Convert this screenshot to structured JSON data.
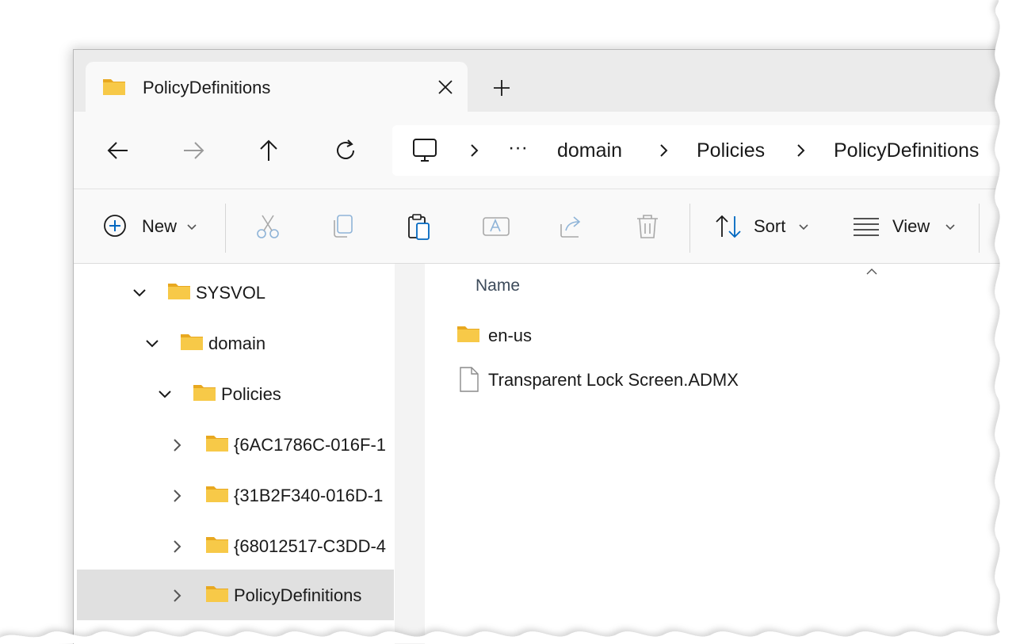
{
  "tab": {
    "title": "PolicyDefinitions",
    "icon": "folder-icon"
  },
  "address": {
    "root_icon": "computer-icon",
    "overflow": "···",
    "crumbs": [
      "domain",
      "Policies",
      "PolicyDefinitions"
    ]
  },
  "commands": {
    "new_label": "New",
    "sort_label": "Sort",
    "view_label": "View"
  },
  "tree": [
    {
      "label": "SYSVOL",
      "expanded": true
    },
    {
      "label": "domain",
      "expanded": true
    },
    {
      "label": "Policies",
      "expanded": true
    },
    {
      "label": "{6AC1786C-016F-1",
      "expanded": false
    },
    {
      "label": "{31B2F340-016D-1",
      "expanded": false
    },
    {
      "label": "{68012517-C3DD-4",
      "expanded": false
    },
    {
      "label": "PolicyDefinitions",
      "expanded": false,
      "selected": true
    }
  ],
  "content": {
    "column_name": "Name",
    "items": [
      {
        "label": "en-us",
        "type": "folder"
      },
      {
        "label": "Transparent Lock Screen.ADMX",
        "type": "file"
      }
    ]
  },
  "colors": {
    "folder": "#f7c948",
    "folder_dark": "#e8a820",
    "selected": "#e0e0e0",
    "accent": "#0067c0"
  }
}
